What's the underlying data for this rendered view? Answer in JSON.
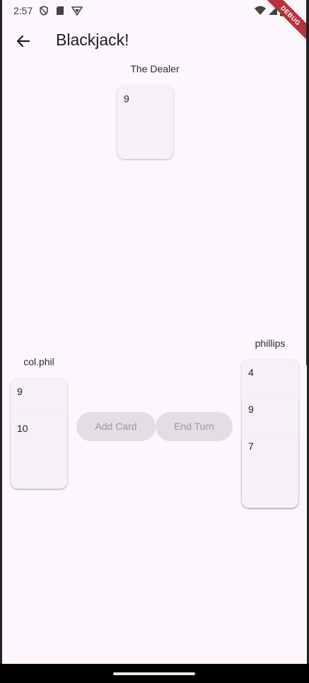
{
  "status": {
    "time": "2:57"
  },
  "debug_label": "DEBUG",
  "app_bar": {
    "title": "Blackjack!",
    "back_icon": "arrow-back-icon"
  },
  "dealer": {
    "name": "The Dealer",
    "cards": [
      "9"
    ]
  },
  "players": [
    {
      "name": "col.phil",
      "cards": [
        "9",
        "10"
      ]
    },
    {
      "name": "phillips",
      "cards": [
        "4",
        "9",
        "7"
      ]
    }
  ],
  "actions": {
    "add_card": "Add Card",
    "end_turn": "End Turn"
  }
}
